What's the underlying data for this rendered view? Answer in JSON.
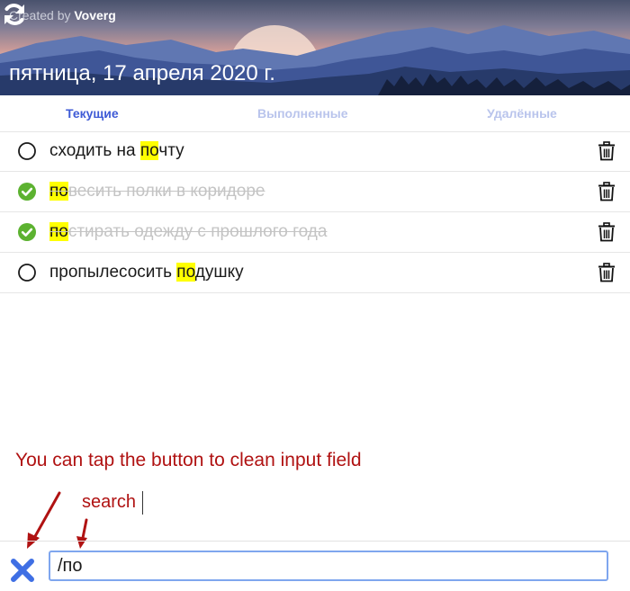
{
  "header": {
    "credit_prefix": "Created by",
    "credit_author": "Voverg",
    "date": "пятница, 17 апреля 2020 г."
  },
  "tabs": [
    {
      "label": "Текущие",
      "active": true
    },
    {
      "label": "Выполненные",
      "active": false
    },
    {
      "label": "Удалённые",
      "active": false
    }
  ],
  "tasks": [
    {
      "before": "сходить на ",
      "match": "по",
      "after": "чту",
      "done": false
    },
    {
      "before": "",
      "match": "по",
      "after": "весить полки в коридоре",
      "done": true
    },
    {
      "before": "",
      "match": "по",
      "after": "стирать одежду с прошлого года",
      "done": true
    },
    {
      "before": "пропылесосить ",
      "match": "по",
      "after": "душку",
      "done": false
    }
  ],
  "annotations": {
    "note": "You can tap the button to clean input field",
    "search_label": "search"
  },
  "search": {
    "value": "/по"
  },
  "colors": {
    "accent": "#3f5bd6",
    "done_green": "#5cb230",
    "highlight": "#ffff00",
    "annotation_red": "#b01212",
    "clear_blue": "#3f6fe4"
  }
}
